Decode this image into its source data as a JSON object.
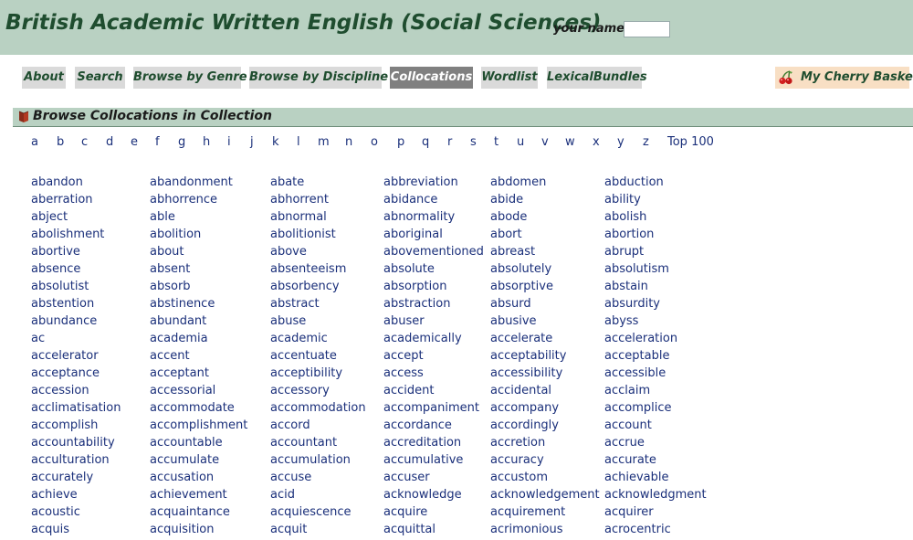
{
  "header": {
    "title": "British Academic Written English (Social Sciences)",
    "name_label": "your name:",
    "name_value": ""
  },
  "nav": {
    "items": [
      {
        "label": "About",
        "active": false
      },
      {
        "label": "Search",
        "active": false
      },
      {
        "label": "Browse by Genre",
        "active": false
      },
      {
        "label": "Browse by Discipline",
        "active": false
      },
      {
        "label": "Collocations",
        "active": true
      },
      {
        "label": "Wordlist",
        "active": false
      },
      {
        "label": "LexicalBundles",
        "active": false
      }
    ],
    "basket_label": "My Cherry Basket",
    "basket_icon": "cherry-icon"
  },
  "section": {
    "title": "Browse Collocations in Collection",
    "icon": "bookmark-icon"
  },
  "letters": [
    "a",
    "b",
    "c",
    "d",
    "e",
    "f",
    "g",
    "h",
    "i",
    "j",
    "k",
    "l",
    "m",
    "n",
    "o",
    "p",
    "q",
    "r",
    "s",
    "t",
    "u",
    "v",
    "w",
    "x",
    "y",
    "z",
    "Top 100"
  ],
  "word_columns": [
    [
      "abandon",
      "aberration",
      "abject",
      "abolishment",
      "abortive",
      "absence",
      "absolutist",
      "abstention",
      "abundance",
      "ac",
      "accelerator",
      "acceptance",
      "accession",
      "acclimatisation",
      "accomplish",
      "accountability",
      "acculturation",
      "accurately",
      "achieve",
      "acoustic",
      "acquis"
    ],
    [
      "abandonment",
      "abhorrence",
      "able",
      "abolition",
      "about",
      "absent",
      "absorb",
      "abstinence",
      "abundant",
      "academia",
      "accent",
      "acceptant",
      "accessorial",
      "accommodate",
      "accomplishment",
      "accountable",
      "accumulate",
      "accusation",
      "achievement",
      "acquaintance",
      "acquisition"
    ],
    [
      "abate",
      "abhorrent",
      "abnormal",
      "abolitionist",
      "above",
      "absenteeism",
      "absorbency",
      "abstract",
      "abuse",
      "academic",
      "accentuate",
      "acceptibility",
      "accessory",
      "accommodation",
      "accord",
      "accountant",
      "accumulation",
      "accuse",
      "acid",
      "acquiescence",
      "acquit"
    ],
    [
      "abbreviation",
      "abidance",
      "abnormality",
      "aboriginal",
      "abovementioned",
      "absolute",
      "absorption",
      "abstraction",
      "abuser",
      "academically",
      "accept",
      "access",
      "accident",
      "accompaniment",
      "accordance",
      "accreditation",
      "accumulative",
      "accuser",
      "acknowledge",
      "acquire",
      "acquittal"
    ],
    [
      "abdomen",
      "abide",
      "abode",
      "abort",
      "abreast",
      "absolutely",
      "absorptive",
      "absurd",
      "abusive",
      "accelerate",
      "acceptability",
      "accessibility",
      "accidental",
      "accompany",
      "accordingly",
      "accretion",
      "accuracy",
      "accustom",
      "acknowledgement",
      "acquirement",
      "acrimonious"
    ],
    [
      "abduction",
      "ability",
      "abolish",
      "abortion",
      "abrupt",
      "absolutism",
      "abstain",
      "absurdity",
      "abyss",
      "acceleration",
      "acceptable",
      "accessible",
      "acclaim",
      "accomplice",
      "account",
      "accrue",
      "accurate",
      "achievable",
      "acknowledgment",
      "acquirer",
      "acrocentric"
    ]
  ]
}
